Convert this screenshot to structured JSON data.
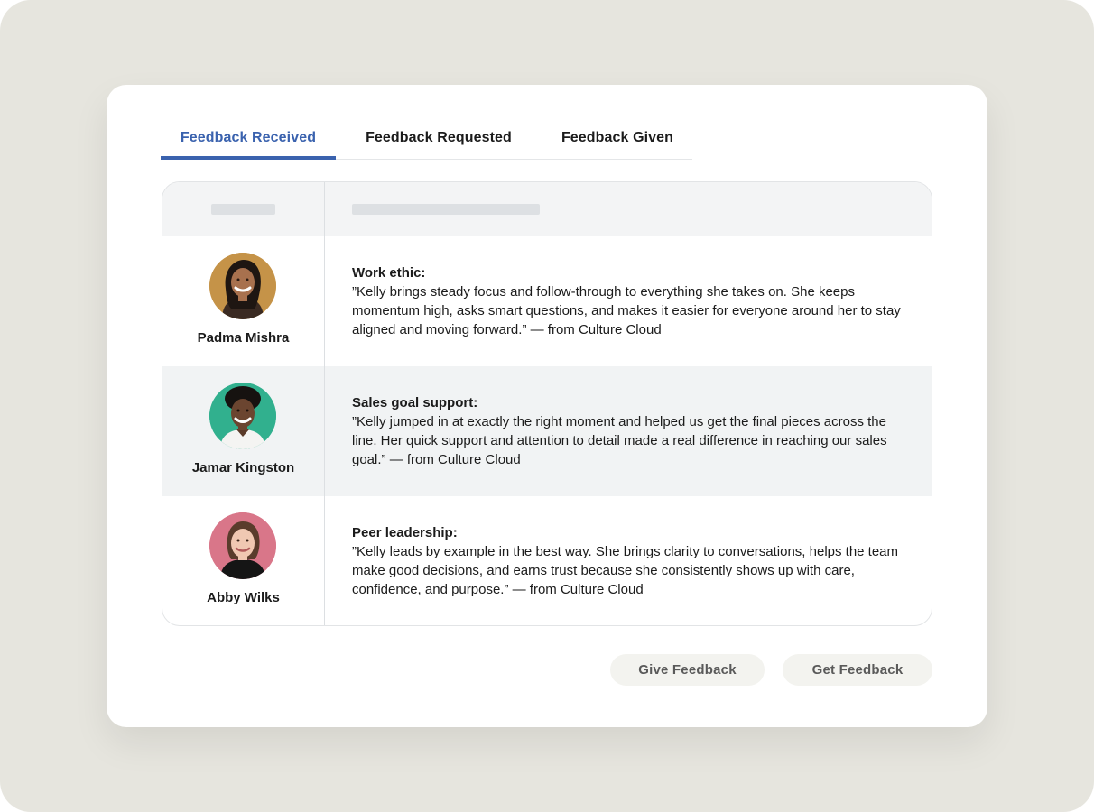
{
  "tabs": [
    {
      "label": "Feedback Received",
      "active": true
    },
    {
      "label": "Feedback Requested",
      "active": false
    },
    {
      "label": "Feedback Given",
      "active": false
    }
  ],
  "colors": {
    "accent": "#3a62ae",
    "page_background": "#e6e5de",
    "row_alt": "#f1f3f4",
    "button_background": "#f3f3ef"
  },
  "feedback": [
    {
      "name": "Padma Mishra",
      "avatar": "person-photo-padma",
      "title": "Work ethic:",
      "quote": "”Kelly brings steady focus and follow-through to everything she takes on. She keeps momentum high, asks smart questions, and makes it easier for everyone around her to stay aligned and moving forward.” — from Culture Cloud"
    },
    {
      "name": "Jamar Kingston",
      "avatar": "person-photo-jamar",
      "title": "Sales goal support:",
      "quote": "”Kelly jumped in at exactly the right moment and helped us get the final pieces across the line. Her quick support and attention to detail made a real difference in reaching our sales goal.” — from Culture Cloud"
    },
    {
      "name": "Abby Wilks",
      "avatar": "person-photo-abby",
      "title": "Peer leadership:",
      "quote": "”Kelly leads by example in the best way. She brings clarity to conversations, helps the team make good decisions, and earns trust because she consistently shows up with care, confidence, and purpose.” — from Culture Cloud"
    }
  ],
  "actions": {
    "give_label": "Give Feedback",
    "get_label": "Get Feedback"
  }
}
